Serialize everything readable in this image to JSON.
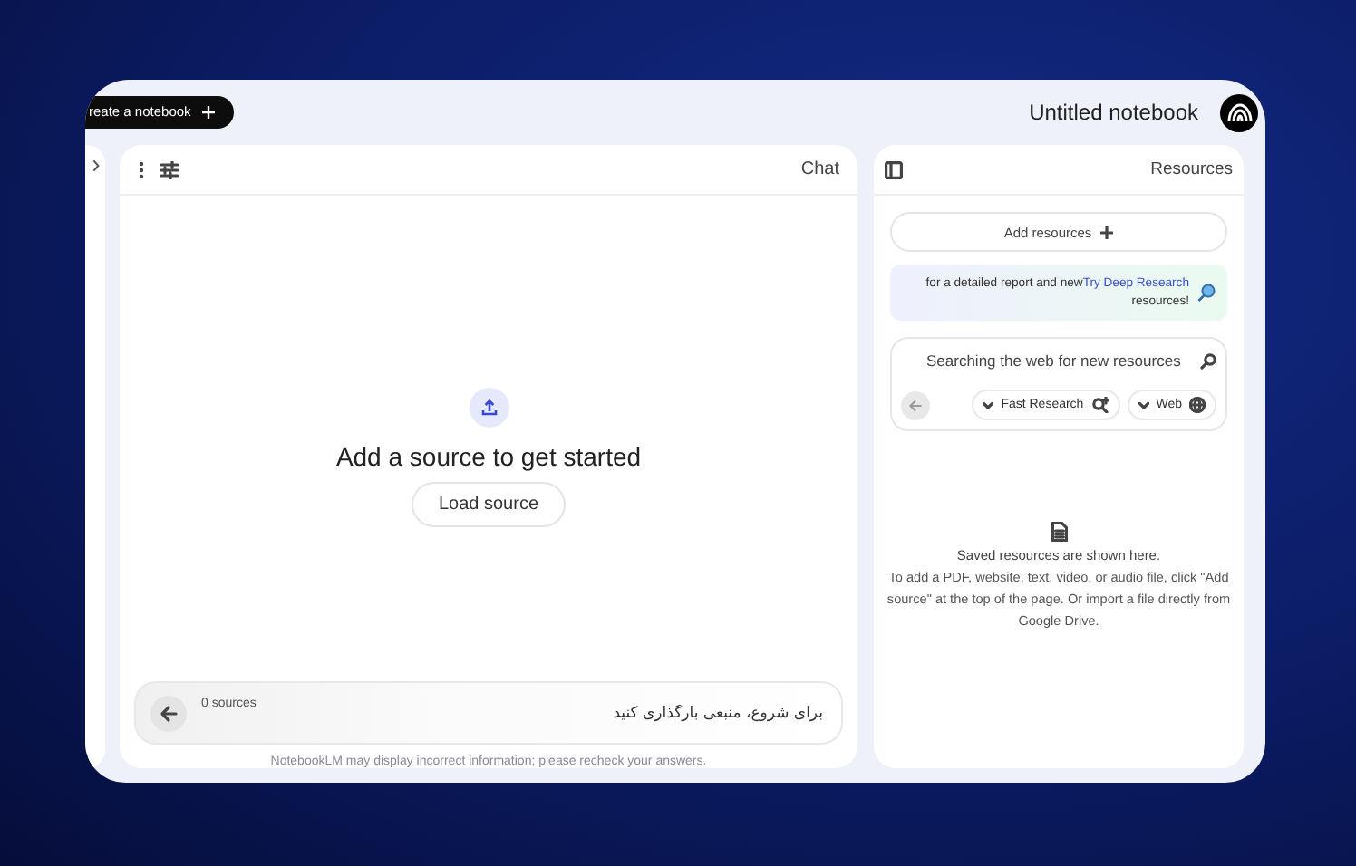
{
  "header": {
    "create_button": "reate a notebook",
    "title": "Untitled notebook"
  },
  "chat": {
    "title": "Chat",
    "heading": "Add a source to get started",
    "load_button": "Load source",
    "source_count": "0 sources",
    "placeholder": "برای شروع، منبعی بارگذاری کنید",
    "disclaimer": "NotebookLM may display incorrect information; please recheck your answers."
  },
  "resources": {
    "title": "Resources",
    "add_button": "Add resources",
    "promo": {
      "text": "for a detailed report and new",
      "link": "Try Deep Research",
      "text_2": "resources!"
    },
    "search": {
      "placeholder": "Searching the web for new resources",
      "mode": "Fast Research",
      "source": "Web"
    },
    "empty": {
      "heading": "Saved resources are shown here.",
      "body": "To add a PDF, website, text, video, or audio file, click \"Add source\" at the top of the page. Or import a file directly from Google Drive."
    }
  }
}
